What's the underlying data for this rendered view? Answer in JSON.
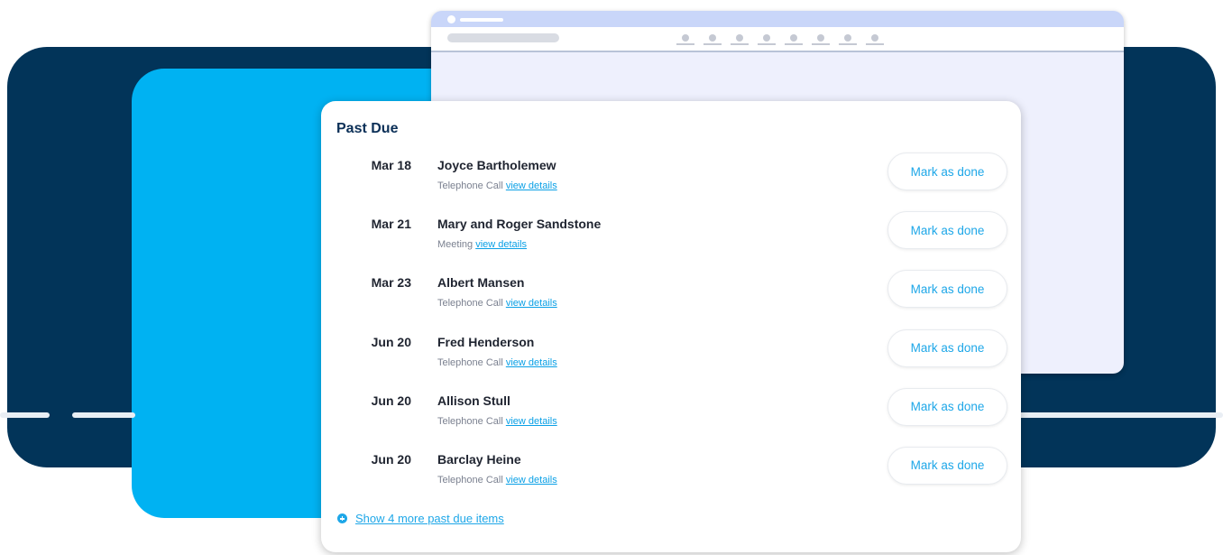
{
  "colors": {
    "navy": "#023459",
    "cyan": "#00b2f2",
    "accent": "#1ea7e8",
    "title": "#0b2f57"
  },
  "browser": {
    "nav_dot_count": 8
  },
  "past_due": {
    "title": "Past Due",
    "button_label": "Mark as done",
    "link_label": "view details",
    "items": [
      {
        "date": "Mar 18",
        "name": "Joyce Bartholemew",
        "type": "Telephone Call"
      },
      {
        "date": "Mar 21",
        "name": "Mary and Roger Sandstone",
        "type": "Meeting"
      },
      {
        "date": "Mar 23",
        "name": "Albert Mansen",
        "type": "Telephone Call"
      },
      {
        "date": "Jun 20",
        "name": "Fred Henderson",
        "type": "Telephone Call"
      },
      {
        "date": "Jun 20",
        "name": "Allison Stull",
        "type": "Telephone Call"
      },
      {
        "date": "Jun 20",
        "name": "Barclay Heine",
        "type": "Telephone Call"
      }
    ],
    "show_more_label": "Show 4 more past due items"
  }
}
